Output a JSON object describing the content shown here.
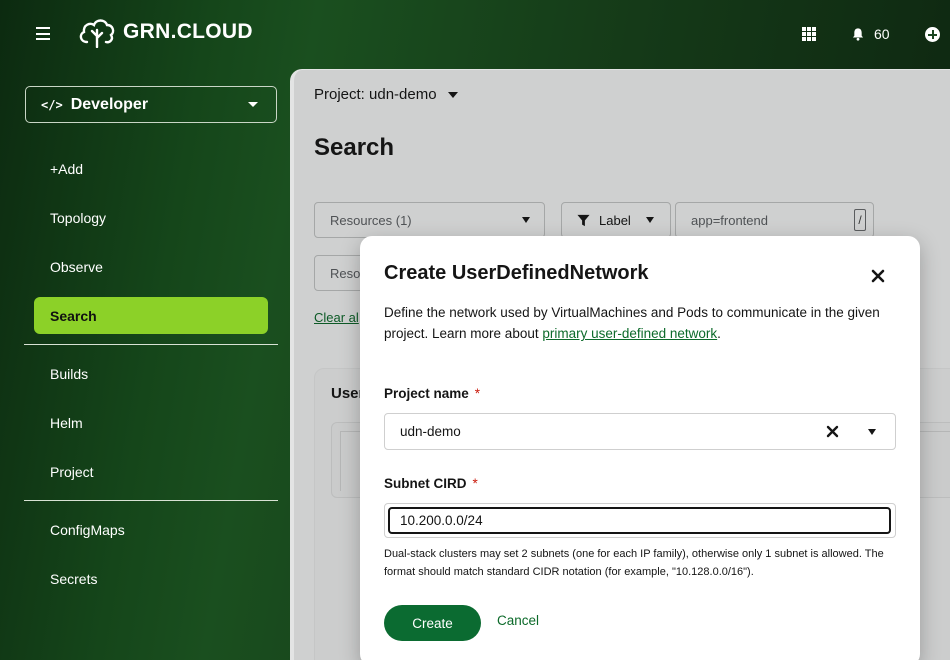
{
  "masthead": {
    "logo_text": "GRN.CLOUD",
    "notification_count": "60"
  },
  "sidebar": {
    "perspective_label": "Developer",
    "perspective_icon": "</>",
    "items": [
      {
        "label": "+Add"
      },
      {
        "label": "Topology"
      },
      {
        "label": "Observe"
      },
      {
        "label": "Search"
      },
      {
        "label": "Builds"
      },
      {
        "label": "Helm"
      },
      {
        "label": "Project"
      },
      {
        "label": "ConfigMaps"
      },
      {
        "label": "Secrets"
      }
    ],
    "active_item": "Search"
  },
  "main": {
    "project_selector": "Project: udn-demo",
    "page_title": "Search",
    "resources_select": "Resources (1)",
    "filter_label": "Label",
    "label_query": "app=frontend",
    "label_shortcut": "/",
    "second_select_partial": "Resou",
    "clear_all_partial": "Clear al",
    "results_title_partial": "User"
  },
  "modal": {
    "title": "Create UserDefinedNetwork",
    "description_prefix": "Define the network used by VirtualMachines and Pods to communicate in the given project. Learn more about ",
    "description_link": "primary user-defined network",
    "description_suffix": ".",
    "project_name_label": "Project name",
    "required_mark": "*",
    "project_name_value": "udn-demo",
    "subnet_label": "Subnet CIRD",
    "subnet_value": "10.200.0.0/24",
    "subnet_helper": "Dual-stack clusters may set 2 subnets (one for each IP family), otherwise only 1 subnet is allowed. The format should match standard CIDR notation (for example, \"10.128.0.0/16\").",
    "create_label": "Create",
    "cancel_label": "Cancel"
  },
  "colors": {
    "accent_active": "#8cd128",
    "primary_button": "#0b6b31",
    "link": "#0c6a2a",
    "required": "#c9190b"
  }
}
